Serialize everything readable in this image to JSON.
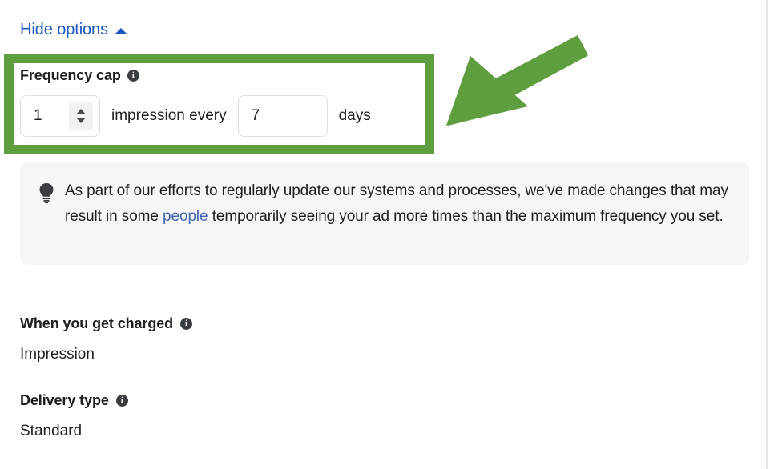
{
  "panel": {
    "hide_options": {
      "label": "Hide options",
      "caret_icon": "chevron-up-icon"
    }
  },
  "frequency_cap": {
    "title": "Frequency cap",
    "info_icon": "info-icon",
    "info_glyph": "i",
    "impressions": {
      "value": "1",
      "stepper_up_icon": "triangle-up-icon",
      "stepper_down_icon": "triangle-down-icon"
    },
    "middle_label": "impression every",
    "days": {
      "value": "7"
    },
    "unit_label": "days",
    "highlight_color": "#5e9e3e"
  },
  "annotation": {
    "arrow_icon": "arrow-pointing-down-left-icon",
    "arrow_color": "#5e9e3e"
  },
  "notice": {
    "icon": "lightbulb-icon",
    "text_part1": "As part of our efforts to regularly update our systems and processes, we've made changes that may result in some ",
    "link_text": "people",
    "text_part2": " temporarily seeing your ad more times than the maximum frequency you set.",
    "link_color": "#4267b2",
    "background": "#f5f6f7"
  },
  "details": [
    {
      "title": "When you get charged",
      "info_icon": "info-icon",
      "info_glyph": "i",
      "value": "Impression"
    },
    {
      "title": "Delivery type",
      "info_icon": "info-icon",
      "info_glyph": "i",
      "value": "Standard"
    }
  ]
}
